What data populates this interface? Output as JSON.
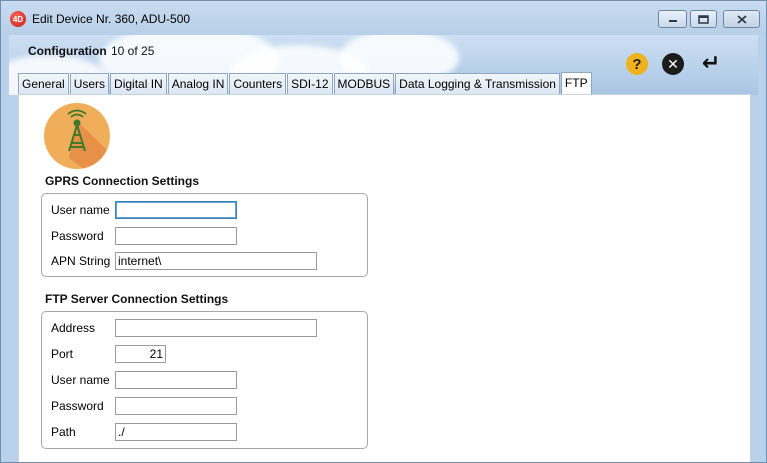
{
  "window": {
    "title": "Edit Device Nr. 360, ADU-500",
    "app_icon_text": "4D"
  },
  "header": {
    "config_label": "Configuration",
    "config_count": "10 of 25",
    "help_glyph": "?",
    "cancel_glyph": "✕",
    "enter_glyph": "↵"
  },
  "tabs": [
    {
      "label": "General"
    },
    {
      "label": "Users"
    },
    {
      "label": "Digital IN"
    },
    {
      "label": "Analog IN"
    },
    {
      "label": "Counters"
    },
    {
      "label": "SDI-12"
    },
    {
      "label": "MODBUS"
    },
    {
      "label": "Data Logging & Transmission"
    },
    {
      "label": "FTP",
      "active": true
    }
  ],
  "gprs": {
    "title": "GPRS Connection Settings",
    "username_label": "User name",
    "username_value": "",
    "password_label": "Password",
    "password_value": "",
    "apn_label": "APN String",
    "apn_value": "internet\\"
  },
  "ftp": {
    "title": "FTP Server Connection Settings",
    "address_label": "Address",
    "address_value": "",
    "port_label": "Port",
    "port_value": "21",
    "username_label": "User name",
    "username_value": "",
    "password_label": "Password",
    "password_value": "",
    "path_label": "Path",
    "path_value": "./"
  },
  "icons": {
    "app": "4d-logo-icon",
    "logo": "ftp-tower-icon",
    "help": "help-icon",
    "cancel": "cancel-icon",
    "enter": "enter-icon"
  },
  "colors": {
    "titlebar": "#b9d1ea",
    "help": "#f0b21d",
    "logo_bg": "#f0ad5a",
    "focus_border": "#3c7fb1"
  }
}
